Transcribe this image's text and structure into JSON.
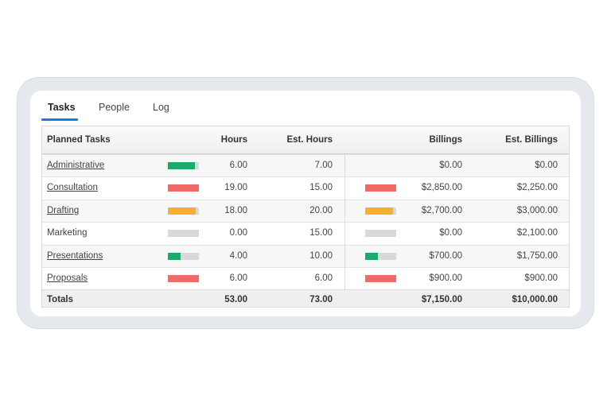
{
  "colors": {
    "green": "#1aab6b",
    "red": "#f26a67",
    "orange": "#f8ad34",
    "accent": "#1e7be0",
    "track": "#d9d9d9"
  },
  "tabs": [
    {
      "label": "Tasks",
      "active": true
    },
    {
      "label": "People",
      "active": false
    },
    {
      "label": "Log",
      "active": false
    }
  ],
  "table": {
    "headers": {
      "task": "Planned Tasks",
      "hours": "Hours",
      "est_hours": "Est. Hours",
      "billings": "Billings",
      "est_billings": "Est. Billings"
    },
    "rows": [
      {
        "task": "Administrative",
        "link": true,
        "hours": "6.00",
        "est_hours": "7.00",
        "billings": "$0.00",
        "est_billings": "$0.00",
        "hours_bar": {
          "fraction": 0.86,
          "color": "green"
        },
        "billings_bar": null
      },
      {
        "task": "Consultation",
        "link": true,
        "hours": "19.00",
        "est_hours": "15.00",
        "billings": "$2,850.00",
        "est_billings": "$2,250.00",
        "hours_bar": {
          "fraction": 1.0,
          "color": "red"
        },
        "billings_bar": {
          "fraction": 1.0,
          "color": "red"
        }
      },
      {
        "task": "Drafting",
        "link": true,
        "hours": "18.00",
        "est_hours": "20.00",
        "billings": "$2,700.00",
        "est_billings": "$3,000.00",
        "hours_bar": {
          "fraction": 0.9,
          "color": "orange"
        },
        "billings_bar": {
          "fraction": 0.9,
          "color": "orange"
        }
      },
      {
        "task": "Marketing",
        "link": false,
        "hours": "0.00",
        "est_hours": "15.00",
        "billings": "$0.00",
        "est_billings": "$2,100.00",
        "hours_bar": {
          "fraction": 0.0,
          "color": "green"
        },
        "billings_bar": {
          "fraction": 0.0,
          "color": "green"
        }
      },
      {
        "task": "Presentations",
        "link": true,
        "hours": "4.00",
        "est_hours": "10.00",
        "billings": "$700.00",
        "est_billings": "$1,750.00",
        "hours_bar": {
          "fraction": 0.4,
          "color": "green"
        },
        "billings_bar": {
          "fraction": 0.4,
          "color": "green"
        }
      },
      {
        "task": "Proposals",
        "link": true,
        "hours": "6.00",
        "est_hours": "6.00",
        "billings": "$900.00",
        "est_billings": "$900.00",
        "hours_bar": {
          "fraction": 1.0,
          "color": "red"
        },
        "billings_bar": {
          "fraction": 1.0,
          "color": "red"
        }
      }
    ],
    "totals": {
      "label": "Totals",
      "hours": "53.00",
      "est_hours": "73.00",
      "billings": "$7,150.00",
      "est_billings": "$10,000.00"
    }
  }
}
